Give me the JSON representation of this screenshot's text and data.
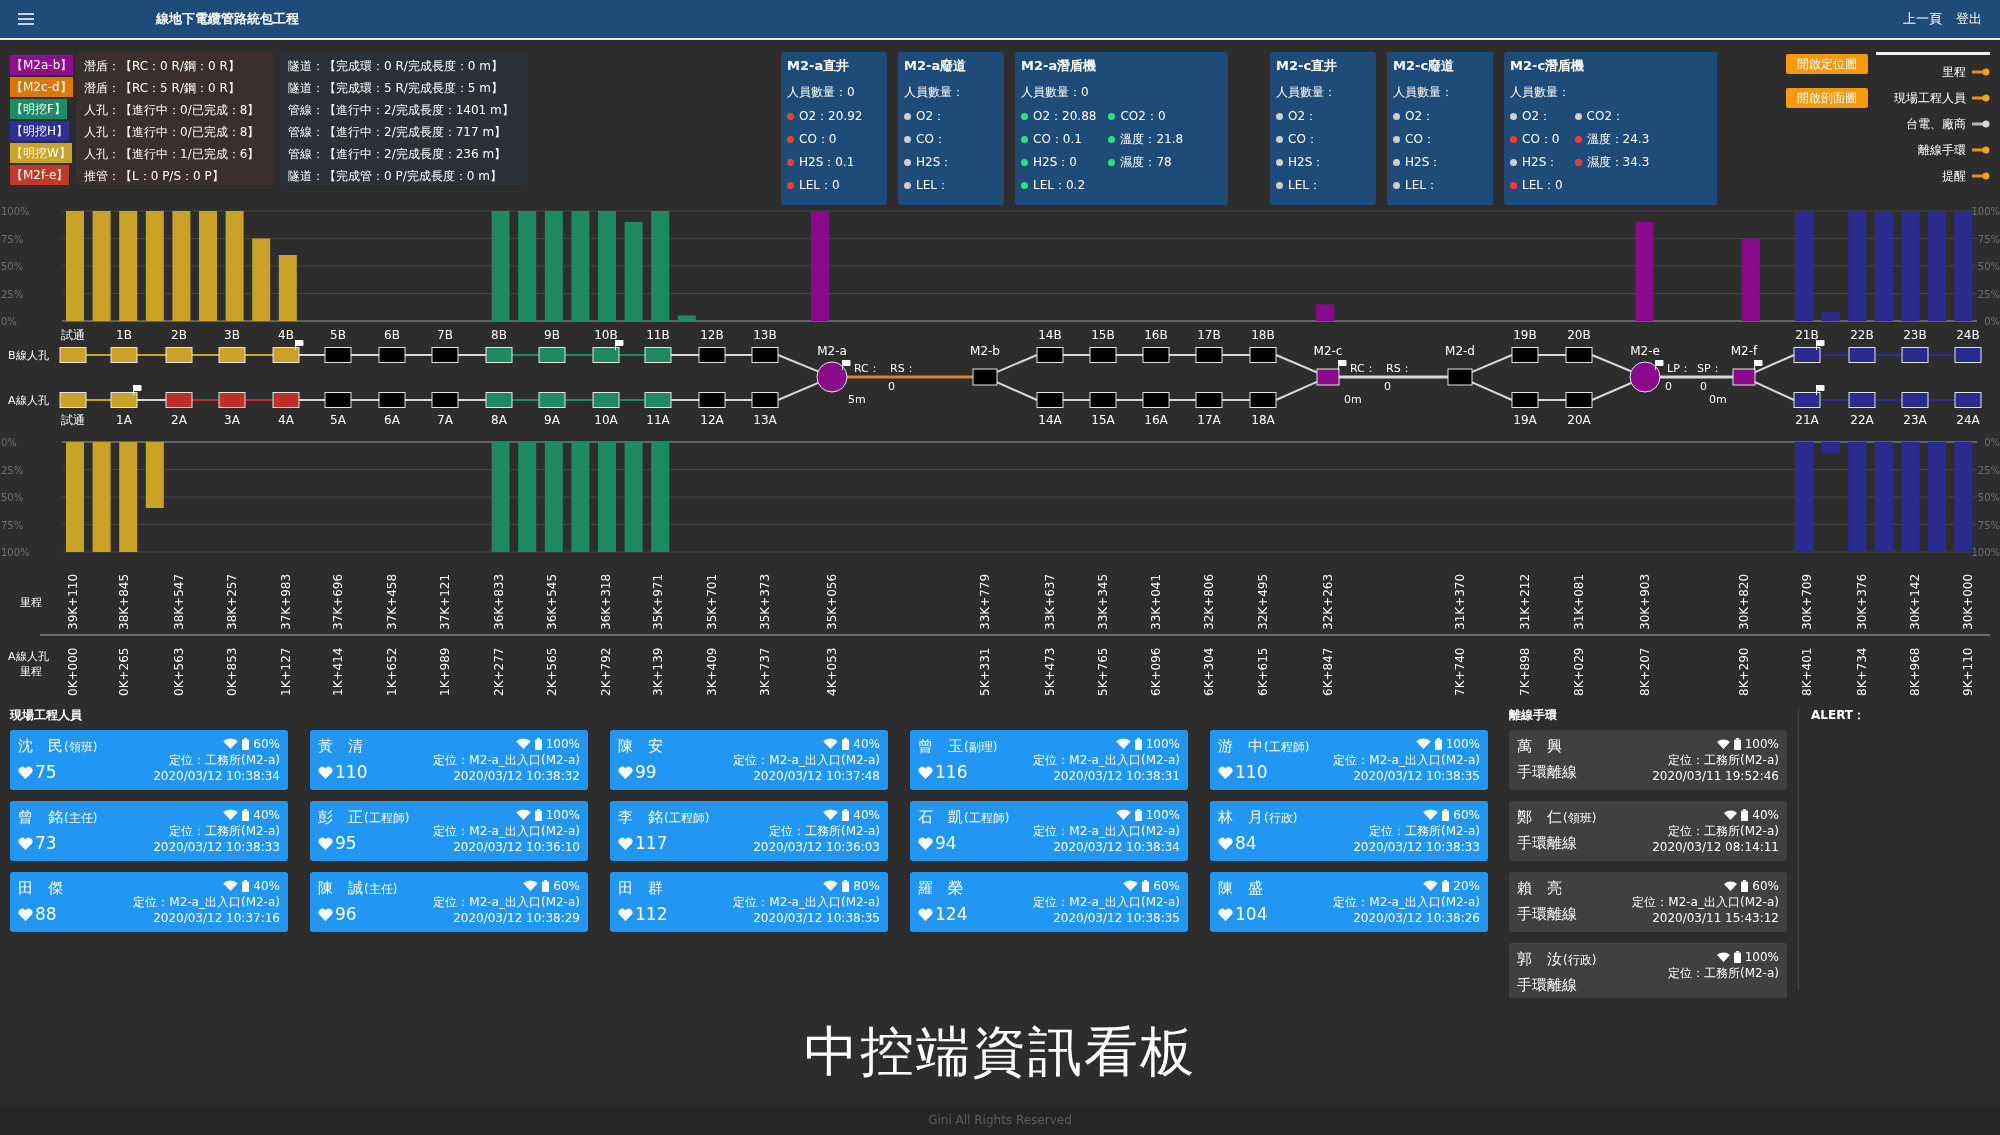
{
  "header": {
    "title": "線地下電纜管路統包工程",
    "nav": [
      "上一頁",
      "登出"
    ]
  },
  "progress_rows": [
    {
      "tag": "【M2a-b】",
      "color": "#8e0e8e",
      "work": "潛盾：【RC：0 R/鋼：0 R】",
      "total": "隧道：【完成環：0 R/完成長度：0 m】"
    },
    {
      "tag": "【M2c-d】",
      "color": "#d97a00",
      "work": "潛盾：【RC：5 R/鋼：0 R】",
      "total": "隧道：【完成環：5 R/完成長度：5 m】"
    },
    {
      "tag": "【明挖F】",
      "color": "#1e8c6a",
      "work": "人孔：【進行中：0/已完成：8】",
      "total": "管線：【進行中：2/完成長度：1401 m】"
    },
    {
      "tag": "【明挖H】",
      "color": "#2e3192",
      "work": "人孔：【進行中：0/已完成：8】",
      "total": "管線：【進行中：2/完成長度：717 m】"
    },
    {
      "tag": "【明挖W】",
      "color": "#c9a227",
      "work": "人孔：【進行中：1/已完成：6】",
      "total": "管線：【進行中：2/完成長度：236 m】"
    },
    {
      "tag": "【M2f-e】",
      "color": "#c0392b",
      "work": "推管：【L：0 P/S：0 P】",
      "total": "隧道：【完成管：0 P/完成長度：0 m】"
    }
  ],
  "sensor_groups": [
    {
      "boxes": [
        {
          "title": "M2-a直井",
          "staff": "人員數量：0",
          "readings": [
            {
              "label": "O2：",
              "value": "20.92",
              "color": "#ff3b30"
            },
            {
              "label": "CO：",
              "value": "0",
              "color": "#ff3b30"
            },
            {
              "label": "H2S：",
              "value": "0.1",
              "color": "#ff3b30"
            },
            {
              "label": "LEL：",
              "value": "0",
              "color": "#ff3b30"
            }
          ]
        },
        {
          "title": "M2-a廢道",
          "staff": "人員數量：",
          "readings": [
            {
              "label": "O2：",
              "color": "#cfcfcf"
            },
            {
              "label": "CO：",
              "color": "#cfcfcf"
            },
            {
              "label": "H2S：",
              "color": "#cfcfcf"
            },
            {
              "label": "LEL：",
              "color": "#cfcfcf"
            }
          ]
        },
        {
          "title": "M2-a潛盾機",
          "staff": "人員數量：0",
          "readings": [
            {
              "label": "O2：",
              "value": "20.88",
              "color": "#2ee07a"
            },
            {
              "label": "CO：",
              "value": "0.1",
              "color": "#2ee07a"
            },
            {
              "label": "H2S：",
              "value": "0",
              "color": "#2ee07a"
            },
            {
              "label": "LEL：",
              "value": "0.2",
              "color": "#2ee07a"
            }
          ],
          "readings_2": [
            {
              "label": "CO2：",
              "value": "0",
              "color": "#2ee07a"
            },
            {
              "label": "溫度：",
              "value": "21.8",
              "color": "#2ee07a"
            },
            {
              "label": "濕度：",
              "value": "78",
              "color": "#2ee07a"
            }
          ]
        }
      ]
    },
    {
      "boxes": [
        {
          "title": "M2-c直井",
          "staff": "人員數量：",
          "readings": [
            {
              "label": "O2：",
              "color": "#cfcfcf"
            },
            {
              "label": "CO：",
              "color": "#cfcfcf"
            },
            {
              "label": "H2S：",
              "color": "#cfcfcf"
            },
            {
              "label": "LEL：",
              "color": "#cfcfcf"
            }
          ]
        },
        {
          "title": "M2-c廢道",
          "staff": "人員數量：",
          "readings": [
            {
              "label": "O2：",
              "color": "#cfcfcf"
            },
            {
              "label": "CO：",
              "color": "#cfcfcf"
            },
            {
              "label": "H2S：",
              "color": "#cfcfcf"
            },
            {
              "label": "LEL：",
              "color": "#cfcfcf"
            }
          ]
        },
        {
          "title": "M2-c潛盾機",
          "staff": "人員數量：",
          "readings": [
            {
              "label": "O2：",
              "color": "#cfcfcf"
            },
            {
              "label": "CO：",
              "value": "0",
              "color": "#ff3b30"
            },
            {
              "label": "H2S：",
              "color": "#cfcfcf"
            },
            {
              "label": "LEL：",
              "value": "0",
              "color": "#ff3b30"
            }
          ],
          "readings_2": [
            {
              "label": "CO2：",
              "color": "#cfcfcf"
            },
            {
              "label": "溫度：",
              "value": "24.3",
              "color": "#ff3b30"
            },
            {
              "label": "濕度：",
              "value": "34.3",
              "color": "#ff3b30"
            }
          ]
        }
      ]
    }
  ],
  "buttons": [
    "開啟定位圖",
    "開啟剖面圖"
  ],
  "layers": [
    {
      "label": "里程",
      "on": true
    },
    {
      "label": "現場工程人員",
      "on": true
    },
    {
      "label": "台電、廠商",
      "on": false
    },
    {
      "label": "離線手環",
      "on": true
    },
    {
      "label": "提醒",
      "on": true
    }
  ],
  "top_chart": {
    "chart_data": {
      "type": "bar",
      "grid": true,
      "ylim": [
        0,
        100
      ],
      "yticks": [
        {
          "value": 0,
          "label": "0%"
        },
        {
          "value": 25,
          "label": "25%"
        },
        {
          "value": 50,
          "label": "50%"
        },
        {
          "value": 75,
          "label": "75%"
        },
        {
          "value": 100,
          "label": "100%"
        }
      ],
      "series": [
        {
          "color": "#c9a227",
          "values": [
            100,
            100,
            100,
            100,
            100,
            100,
            100,
            75,
            60,
            null,
            null,
            null,
            null,
            null,
            null,
            null,
            null,
            null,
            null,
            null,
            null,
            null,
            null,
            null,
            null,
            null,
            null,
            null,
            null,
            null,
            null,
            null,
            null,
            null,
            null,
            null,
            null,
            null,
            null,
            null,
            null,
            null,
            null,
            null,
            null,
            null,
            null,
            null,
            null,
            null,
            null,
            null,
            null,
            null,
            null,
            null,
            null,
            null,
            null,
            null,
            null,
            null,
            null,
            null,
            null,
            null,
            null,
            null,
            null,
            null,
            null,
            null
          ]
        },
        {
          "color": "#1f8a62",
          "values": [
            null,
            null,
            null,
            null,
            null,
            null,
            null,
            null,
            null,
            null,
            null,
            null,
            null,
            null,
            null,
            null,
            100,
            100,
            100,
            100,
            100,
            90,
            100,
            5,
            null,
            null,
            null,
            null,
            null,
            null,
            null,
            null,
            null,
            null,
            null,
            null,
            null,
            null,
            null,
            null,
            null,
            null,
            null,
            null,
            null,
            null,
            null,
            null,
            null,
            null,
            null,
            null,
            null,
            null,
            null,
            null,
            null,
            null,
            null,
            null,
            null,
            null,
            null,
            null,
            null,
            null,
            null,
            null,
            null,
            null,
            null,
            null
          ]
        },
        {
          "color": "#8b0a8b",
          "values": [
            null,
            null,
            null,
            null,
            null,
            null,
            null,
            null,
            null,
            null,
            null,
            null,
            null,
            null,
            null,
            null,
            null,
            null,
            null,
            null,
            null,
            null,
            null,
            null,
            null,
            null,
            null,
            null,
            100,
            null,
            null,
            null,
            null,
            null,
            null,
            null,
            null,
            null,
            null,
            null,
            null,
            null,
            null,
            null,
            null,
            null,
            null,
            15,
            null,
            null,
            null,
            null,
            null,
            null,
            null,
            null,
            null,
            null,
            null,
            90,
            null,
            null,
            null,
            75,
            null,
            null,
            null,
            null,
            null,
            null,
            null,
            null
          ]
        },
        {
          "color": "#2b2b8f",
          "values": [
            null,
            null,
            null,
            null,
            null,
            null,
            null,
            null,
            null,
            null,
            null,
            null,
            null,
            null,
            null,
            null,
            null,
            null,
            null,
            null,
            null,
            null,
            null,
            null,
            null,
            null,
            null,
            null,
            null,
            null,
            null,
            null,
            null,
            null,
            null,
            null,
            null,
            null,
            null,
            null,
            null,
            null,
            null,
            null,
            null,
            null,
            null,
            null,
            null,
            null,
            null,
            null,
            null,
            null,
            null,
            null,
            null,
            null,
            null,
            null,
            null,
            null,
            null,
            null,
            null,
            100,
            8,
            100,
            100,
            100,
            100,
            100
          ]
        }
      ]
    }
  },
  "map": {
    "row_labels": [
      "B線人孔",
      "A線人孔"
    ],
    "columns": [
      {
        "kind": "pair",
        "b": {
          "label": "試通",
          "color": "#c9a227",
          "flag": false
        },
        "a": {
          "label": "試通",
          "color": "#c9a227",
          "flag": false
        }
      },
      {
        "kind": "pair",
        "b": {
          "label": "1B",
          "color": "#c9a227",
          "flag": false
        },
        "a": {
          "label": "1A",
          "color": "#c9a227",
          "flag": true
        }
      },
      {
        "kind": "pair",
        "b": {
          "label": "2B",
          "color": "#c9a227",
          "flag": false
        },
        "a": {
          "label": "2A",
          "color": "#c0302b",
          "flag": false
        }
      },
      {
        "kind": "pair",
        "b": {
          "label": "3B",
          "color": "#c9a227",
          "flag": false
        },
        "a": {
          "label": "3A",
          "color": "#c0302b",
          "flag": false
        }
      },
      {
        "kind": "pair",
        "b": {
          "label": "4B",
          "color": "#c9a227",
          "flag": true
        },
        "a": {
          "label": "4A",
          "color": "#c0302b",
          "flag": false
        }
      },
      {
        "kind": "pair",
        "b": {
          "label": "5B",
          "color": "#000000",
          "flag": false
        },
        "a": {
          "label": "5A",
          "color": "#000000",
          "flag": false
        }
      },
      {
        "kind": "pair",
        "b": {
          "label": "6B",
          "color": "#000000",
          "flag": false
        },
        "a": {
          "label": "6A",
          "color": "#000000",
          "flag": false
        }
      },
      {
        "kind": "pair",
        "b": {
          "label": "7B",
          "color": "#000000",
          "flag": false
        },
        "a": {
          "label": "7A",
          "color": "#000000",
          "flag": false
        }
      },
      {
        "kind": "pair",
        "b": {
          "label": "8B",
          "color": "#1f8a62",
          "flag": false
        },
        "a": {
          "label": "8A",
          "color": "#1f8a62",
          "flag": false
        }
      },
      {
        "kind": "pair",
        "b": {
          "label": "9B",
          "color": "#1f8a62",
          "flag": false
        },
        "a": {
          "label": "9A",
          "color": "#1f8a62",
          "flag": false
        }
      },
      {
        "kind": "pair",
        "b": {
          "label": "10B",
          "color": "#1f8a62",
          "flag": true
        },
        "a": {
          "label": "10A",
          "color": "#1f8a62",
          "flag": false
        }
      },
      {
        "kind": "pair",
        "b": {
          "label": "11B",
          "color": "#1f8a62",
          "flag": false
        },
        "a": {
          "label": "11A",
          "color": "#1f8a62",
          "flag": false
        }
      },
      {
        "kind": "pair",
        "b": {
          "label": "12B",
          "color": "#000000",
          "flag": false
        },
        "a": {
          "label": "12A",
          "color": "#000000",
          "flag": false
        }
      },
      {
        "kind": "pair",
        "b": {
          "label": "13B",
          "color": "#000000",
          "flag": false
        },
        "a": {
          "label": "13A",
          "color": "#000000",
          "flag": false
        }
      },
      {
        "kind": "circle",
        "label": "M2-a",
        "color": "#8b0a8b",
        "flag": true,
        "link_active": true,
        "notes": [
          "RC：",
          "RS：",
          "0",
          "5m"
        ]
      },
      {
        "kind": "box",
        "label": "M2-b",
        "color": "#000000",
        "flag": false
      },
      {
        "kind": "pair",
        "b": {
          "label": "14B",
          "color": "#000000",
          "flag": false
        },
        "a": {
          "label": "14A",
          "color": "#000000",
          "flag": false
        }
      },
      {
        "kind": "pair",
        "b": {
          "label": "15B",
          "color": "#000000",
          "flag": false
        },
        "a": {
          "label": "15A",
          "color": "#000000",
          "flag": false
        }
      },
      {
        "kind": "pair",
        "b": {
          "label": "16B",
          "color": "#000000",
          "flag": false
        },
        "a": {
          "label": "16A",
          "color": "#000000",
          "flag": false
        }
      },
      {
        "kind": "pair",
        "b": {
          "label": "17B",
          "color": "#000000",
          "flag": false
        },
        "a": {
          "label": "17A",
          "color": "#000000",
          "flag": false
        }
      },
      {
        "kind": "pair",
        "b": {
          "label": "18B",
          "color": "#000000",
          "flag": false
        },
        "a": {
          "label": "18A",
          "color": "#000000",
          "flag": false
        }
      },
      {
        "kind": "square",
        "label": "M2-c",
        "color": "#8b0a8b",
        "flag": true,
        "link_active": false,
        "notes": [
          "RC：",
          "RS：",
          "0",
          "0m"
        ]
      },
      {
        "kind": "box",
        "label": "M2-d",
        "color": "#000000",
        "flag": false
      },
      {
        "kind": "pair",
        "b": {
          "label": "19B",
          "color": "#000000",
          "flag": false
        },
        "a": {
          "label": "19A",
          "color": "#000000",
          "flag": false
        }
      },
      {
        "kind": "pair",
        "b": {
          "label": "20B",
          "color": "#000000",
          "flag": false
        },
        "a": {
          "label": "20A",
          "color": "#000000",
          "flag": false
        }
      },
      {
        "kind": "circle",
        "label": "M2-e",
        "color": "#8b0a8b",
        "flag": true,
        "link_active": false,
        "notes": [
          "LP：",
          "SP：",
          "0",
          "0",
          "0m"
        ]
      },
      {
        "kind": "square",
        "label": "M2-f",
        "color": "#8b0a8b",
        "flag": true
      },
      {
        "kind": "pair",
        "b": {
          "label": "21B",
          "color": "#2b2b8f",
          "flag": true
        },
        "a": {
          "label": "21A",
          "color": "#2b2b8f",
          "flag": true
        }
      },
      {
        "kind": "pair",
        "b": {
          "label": "22B",
          "color": "#2b2b8f",
          "flag": false
        },
        "a": {
          "label": "22A",
          "color": "#2b2b8f",
          "flag": false
        }
      },
      {
        "kind": "pair",
        "b": {
          "label": "23B",
          "color": "#2b2b8f",
          "flag": false
        },
        "a": {
          "label": "23A",
          "color": "#2b2b8f",
          "flag": false
        }
      },
      {
        "kind": "pair",
        "b": {
          "label": "24B",
          "color": "#2b2b8f",
          "flag": false
        },
        "a": {
          "label": "24A",
          "color": "#2b2b8f",
          "flag": false
        }
      }
    ]
  },
  "bottom_chart": {
    "chart_data": {
      "type": "bar",
      "grid": true,
      "ylim": [
        100,
        0
      ],
      "yticks": [
        {
          "value": 0,
          "label": "0%"
        },
        {
          "value": 25,
          "label": "25%"
        },
        {
          "value": 50,
          "label": "50%"
        },
        {
          "value": 75,
          "label": "75%"
        },
        {
          "value": 100,
          "label": "100%"
        }
      ],
      "series": [
        {
          "color": "#c9a227",
          "values": [
            100,
            100,
            100,
            60,
            null,
            null,
            null,
            null,
            null,
            null,
            null,
            null,
            null,
            null,
            null,
            null,
            null,
            null,
            null,
            null,
            null,
            null,
            null,
            null,
            null,
            null,
            null,
            null,
            null,
            null,
            null,
            null,
            null,
            null,
            null,
            null,
            null,
            null,
            null,
            null,
            null,
            null,
            null,
            null,
            null,
            null,
            null,
            null,
            null,
            null,
            null,
            null,
            null,
            null,
            null,
            null,
            null,
            null,
            null,
            null,
            null,
            null,
            null,
            null,
            null,
            null,
            null,
            null,
            null,
            null,
            null,
            null
          ]
        },
        {
          "color": "#1f8a62",
          "values": [
            null,
            null,
            null,
            null,
            null,
            null,
            null,
            null,
            null,
            null,
            null,
            null,
            null,
            null,
            null,
            null,
            100,
            100,
            100,
            100,
            100,
            100,
            100,
            null,
            null,
            null,
            null,
            null,
            null,
            null,
            null,
            null,
            null,
            null,
            null,
            null,
            null,
            null,
            null,
            null,
            null,
            null,
            null,
            null,
            null,
            null,
            null,
            null,
            null,
            null,
            null,
            null,
            null,
            null,
            null,
            null,
            null,
            null,
            null,
            null,
            null,
            null,
            null,
            null,
            null,
            null,
            null,
            null,
            null,
            null,
            null,
            null
          ]
        },
        {
          "color": "#2b2b8f",
          "values": [
            null,
            null,
            null,
            null,
            null,
            null,
            null,
            null,
            null,
            null,
            null,
            null,
            null,
            null,
            null,
            null,
            null,
            null,
            null,
            null,
            null,
            null,
            null,
            null,
            null,
            null,
            null,
            null,
            null,
            null,
            null,
            null,
            null,
            null,
            null,
            null,
            null,
            null,
            null,
            null,
            null,
            null,
            null,
            null,
            null,
            null,
            null,
            null,
            null,
            null,
            null,
            null,
            null,
            null,
            null,
            null,
            null,
            null,
            null,
            null,
            null,
            null,
            null,
            null,
            null,
            100,
            10,
            100,
            100,
            100,
            100,
            100
          ]
        }
      ]
    }
  },
  "mileage": {
    "b_label": "里程",
    "a_labels": [
      "A線人孔",
      "里程"
    ],
    "b": [
      "39K+110",
      "38K+845",
      "38K+547",
      "38K+257",
      "37K+983",
      "37K+696",
      "37K+458",
      "37K+121",
      "36K+833",
      "36K+545",
      "36K+318",
      "35K+971",
      "35K+701",
      "35K+373",
      "35K+056",
      "33K+779",
      "33K+637",
      "33K+345",
      "33K+041",
      "32K+806",
      "32K+495",
      "32K+263",
      "31K+370",
      "31K+212",
      "31K+081",
      "30K+903",
      "30K+820",
      "30K+709",
      "30K+376",
      "30K+142",
      "30K+000"
    ],
    "a": [
      "0K+000",
      "0K+265",
      "0K+563",
      "0K+853",
      "1K+127",
      "1K+414",
      "1K+652",
      "1K+989",
      "2K+277",
      "2K+565",
      "2K+792",
      "3K+139",
      "3K+409",
      "3K+737",
      "4K+053",
      "5K+331",
      "5K+473",
      "5K+765",
      "6K+096",
      "6K+304",
      "6K+615",
      "6K+847",
      "7K+740",
      "7K+898",
      "8K+029",
      "8K+207",
      "8K+290",
      "8K+401",
      "8K+734",
      "8K+968",
      "9K+110"
    ]
  },
  "staff": {
    "title": "現場工程人員",
    "people": [
      {
        "name": "沈　民",
        "role": "(領班)",
        "battery": "60%",
        "heart": "75",
        "location": "定位：工務所(M2-a)",
        "time": "2020/03/12 10:38:34"
      },
      {
        "name": "黃　清",
        "battery": "100%",
        "heart": "110",
        "location": "定位：M2-a_出入口(M2-a)",
        "time": "2020/03/12 10:38:32"
      },
      {
        "name": "陳　安",
        "battery": "40%",
        "heart": "99",
        "location": "定位：M2-a_出入口(M2-a)",
        "time": "2020/03/12 10:37:48"
      },
      {
        "name": "曾　玉",
        "role": "(副理)",
        "battery": "100%",
        "heart": "116",
        "location": "定位：M2-a_出入口(M2-a)",
        "time": "2020/03/12 10:38:31"
      },
      {
        "name": "游　中",
        "role": "(工程師)",
        "battery": "100%",
        "heart": "110",
        "location": "定位：M2-a_出入口(M2-a)",
        "time": "2020/03/12 10:38:35"
      },
      {
        "name": "曾　銘",
        "role": "(主任)",
        "battery": "40%",
        "heart": "73",
        "location": "定位：工務所(M2-a)",
        "time": "2020/03/12 10:38:33"
      },
      {
        "name": "彭　正",
        "role": "(工程師)",
        "battery": "100%",
        "heart": "95",
        "location": "定位：M2-a_出入口(M2-a)",
        "time": "2020/03/12 10:36:10"
      },
      {
        "name": "李　銘",
        "role": "(工程師)",
        "battery": "40%",
        "heart": "117",
        "location": "定位：工務所(M2-a)",
        "time": "2020/03/12 10:36:03"
      },
      {
        "name": "石　凱",
        "role": "(工程師)",
        "battery": "100%",
        "heart": "94",
        "location": "定位：M2-a_出入口(M2-a)",
        "time": "2020/03/12 10:38:34"
      },
      {
        "name": "林　月",
        "role": "(行政)",
        "battery": "60%",
        "heart": "84",
        "location": "定位：工務所(M2-a)",
        "time": "2020/03/12 10:38:33"
      },
      {
        "name": "田　傑",
        "battery": "40%",
        "heart": "88",
        "location": "定位：M2-a_出入口(M2-a)",
        "time": "2020/03/12 10:37:16"
      },
      {
        "name": "陳　誠",
        "role": "(主任)",
        "battery": "60%",
        "heart": "96",
        "location": "定位：M2-a_出入口(M2-a)",
        "time": "2020/03/12 10:38:29"
      },
      {
        "name": "田　群",
        "battery": "80%",
        "heart": "112",
        "location": "定位：M2-a_出入口(M2-a)",
        "time": "2020/03/12 10:38:35"
      },
      {
        "name": "羅　榮",
        "battery": "60%",
        "heart": "124",
        "location": "定位：M2-a_出入口(M2-a)",
        "time": "2020/03/12 10:38:35"
      },
      {
        "name": "陳　盛",
        "battery": "20%",
        "heart": "104",
        "location": "定位：M2-a_出入口(M2-a)",
        "time": "2020/03/12 10:38:26"
      }
    ]
  },
  "offline": {
    "title": "離線手環",
    "people": [
      {
        "name": "萬　興",
        "battery": "100%",
        "status": "手環離線",
        "location": "定位：工務所(M2-a)",
        "time": "2020/03/11 19:52:46"
      },
      {
        "name": "鄭　仁",
        "role": "(領班)",
        "battery": "40%",
        "status": "手環離線",
        "location": "定位：工務所(M2-a)",
        "time": "2020/03/12 08:14:11"
      },
      {
        "name": "賴　亮",
        "battery": "60%",
        "status": "手環離線",
        "location": "定位：M2-a_出入口(M2-a)",
        "time": "2020/03/11 15:43:12"
      },
      {
        "name": "郭　汝",
        "role": "(行政)",
        "battery": "100%",
        "status": "手環離線",
        "location": "定位：工務所(M2-a)"
      }
    ]
  },
  "alert": {
    "title": "ALERT："
  },
  "board_title": "中控端資訊看板",
  "footer": "Gini All Rights Reserved"
}
